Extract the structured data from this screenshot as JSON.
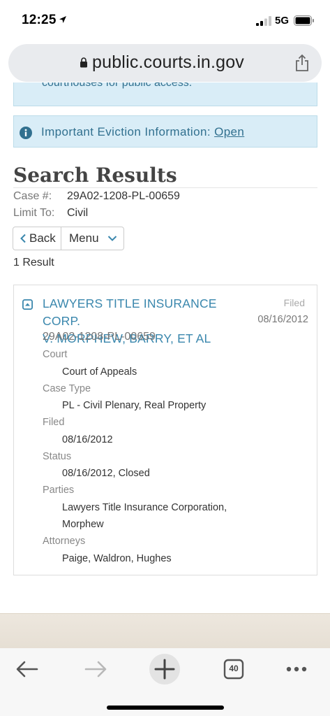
{
  "status_bar": {
    "time": "12:25",
    "network": "5G"
  },
  "browser": {
    "url": "public.courts.in.gov",
    "tab_count": "40"
  },
  "banners": {
    "top_partial_text": "courthouses for public access.",
    "eviction_label": "Important Eviction Information:",
    "eviction_link": "Open"
  },
  "search": {
    "title": "Search Results",
    "case_label": "Case #:",
    "case_value": "29A02-1208-PL-00659",
    "limit_label": "Limit To:",
    "limit_value": "Civil",
    "back_label": "Back",
    "menu_label": "Menu",
    "result_count": "1 Result"
  },
  "result": {
    "title_line1": "LAWYERS TITLE INSURANCE CORP.",
    "title_line2": "V. MORPHEW, BARRY, ET AL",
    "filed_label": "Filed",
    "filed_date": "08/16/2012",
    "case_number": "29A02-1208-PL-00659",
    "fields": {
      "court_label": "Court",
      "court_value": "Court of Appeals",
      "case_type_label": "Case Type",
      "case_type_value": "PL - Civil Plenary, Real Property",
      "filed_label": "Filed",
      "filed_value": "08/16/2012",
      "status_label": "Status",
      "status_value": "08/16/2012, Closed",
      "parties_label": "Parties",
      "parties_line1": "Lawyers Title Insurance Corporation,",
      "parties_line2": "Morphew",
      "attorneys_label": "Attorneys",
      "attorneys_value": "Paige, Waldron, Hughes"
    }
  },
  "icons": {
    "location": "location-arrow-icon",
    "signal": "signal-bars-icon",
    "battery": "battery-icon",
    "lock": "lock-icon",
    "share": "share-icon",
    "info": "info-circle-icon",
    "expand": "collapse-square-icon",
    "back": "back-arrow-icon",
    "forward": "forward-arrow-icon",
    "new_tab": "plus-icon",
    "tabs": "tabs-icon",
    "more": "more-dots-icon"
  },
  "colors": {
    "link_blue": "#3a87ad",
    "info_bg": "#d9edf7",
    "info_text": "#31708f"
  }
}
